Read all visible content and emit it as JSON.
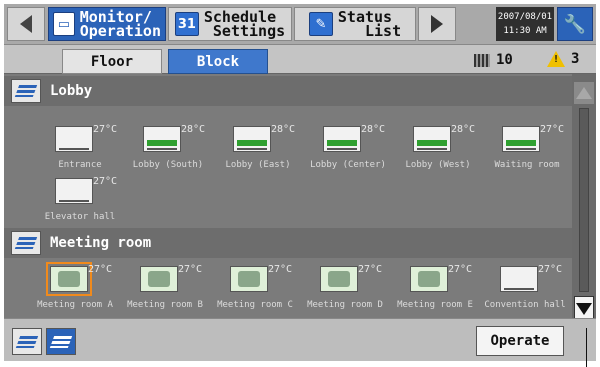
{
  "topbar": {
    "menu": [
      {
        "label": "Monitor/\nOperation",
        "icon": "monitor-icon",
        "active": true
      },
      {
        "label": "Schedule\n Settings",
        "icon": "calendar-icon",
        "active": false
      },
      {
        "label": "Status\n   List",
        "icon": "status-list-icon",
        "active": false
      }
    ],
    "date": "2007/08/01",
    "time": "11:30 AM"
  },
  "tabs": {
    "floor": "Floor",
    "block": "Block"
  },
  "counts": {
    "units": "10",
    "alerts": "3"
  },
  "groups": [
    {
      "title": "Lobby",
      "units": [
        {
          "name": "Entrance",
          "temp": "27°C",
          "mode": "off"
        },
        {
          "name": "Lobby (South)",
          "temp": "28°C",
          "mode": "on"
        },
        {
          "name": "Lobby (East)",
          "temp": "28°C",
          "mode": "on"
        },
        {
          "name": "Lobby (Center)",
          "temp": "28°C",
          "mode": "on"
        },
        {
          "name": "Lobby (West)",
          "temp": "28°C",
          "mode": "on"
        },
        {
          "name": "Waiting room",
          "temp": "27°C",
          "mode": "on"
        },
        {
          "name": "Elevator hall",
          "temp": "27°C",
          "mode": "off"
        }
      ]
    },
    {
      "title": "Meeting room",
      "units": [
        {
          "name": "Meeting room A",
          "temp": "27°C",
          "mode": "cool",
          "selected": true
        },
        {
          "name": "Meeting room B",
          "temp": "27°C",
          "mode": "cool"
        },
        {
          "name": "Meeting room C",
          "temp": "27°C",
          "mode": "cool"
        },
        {
          "name": "Meeting room D",
          "temp": "27°C",
          "mode": "cool"
        },
        {
          "name": "Meeting room E",
          "temp": "27°C",
          "mode": "cool"
        },
        {
          "name": "Convention hall",
          "temp": "27°C",
          "mode": "off"
        }
      ]
    }
  ],
  "bottombar": {
    "operate_label": "Operate"
  }
}
